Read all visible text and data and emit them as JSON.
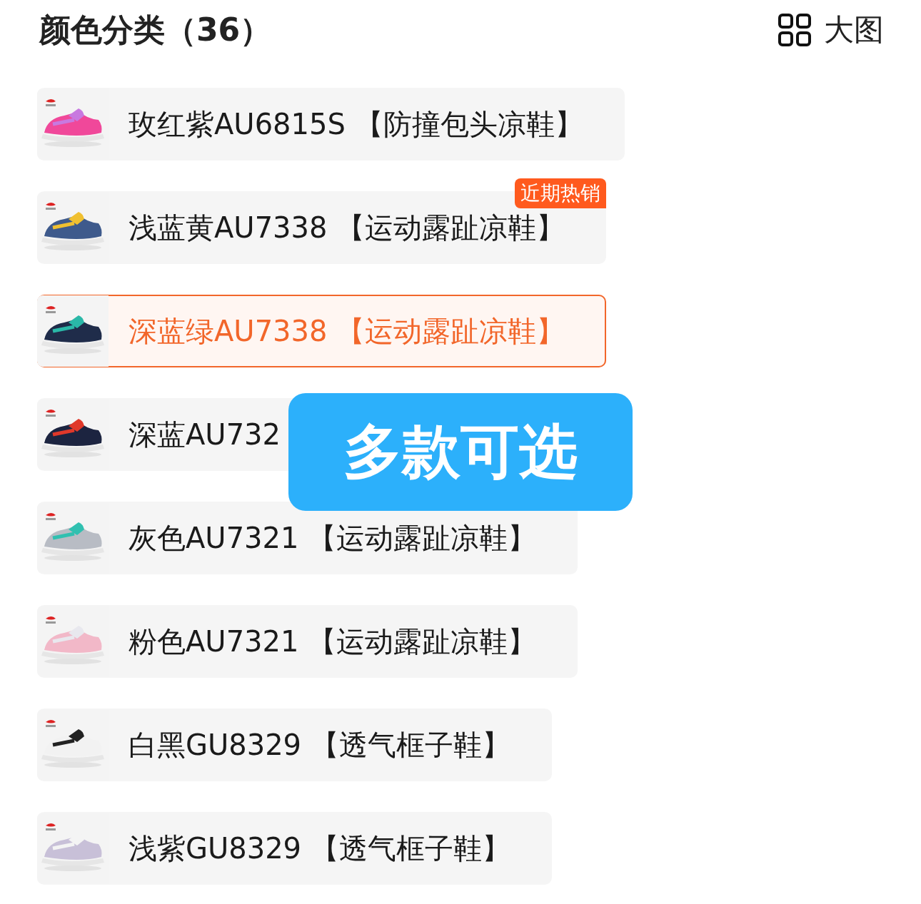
{
  "header": {
    "title": "颜色分类（36）",
    "view_toggle": "大图"
  },
  "options": [
    {
      "label": "玫红紫AU6815S 【防撞包头凉鞋】",
      "selected": false
    },
    {
      "label": "浅蓝黄AU7338 【运动露趾凉鞋】",
      "selected": false,
      "badge": "近期热销"
    },
    {
      "label": "深蓝绿AU7338 【运动露趾凉鞋】",
      "selected": true
    },
    {
      "label": "深蓝AU732",
      "selected": false
    },
    {
      "label": "灰色AU7321 【运动露趾凉鞋】",
      "selected": false
    },
    {
      "label": "粉色AU7321 【运动露趾凉鞋】",
      "selected": false
    },
    {
      "label": "白黑GU8329 【透气框子鞋】",
      "selected": false
    },
    {
      "label": "浅紫GU8329 【透气框子鞋】",
      "selected": false
    }
  ],
  "overlay_banner": "多款可选"
}
